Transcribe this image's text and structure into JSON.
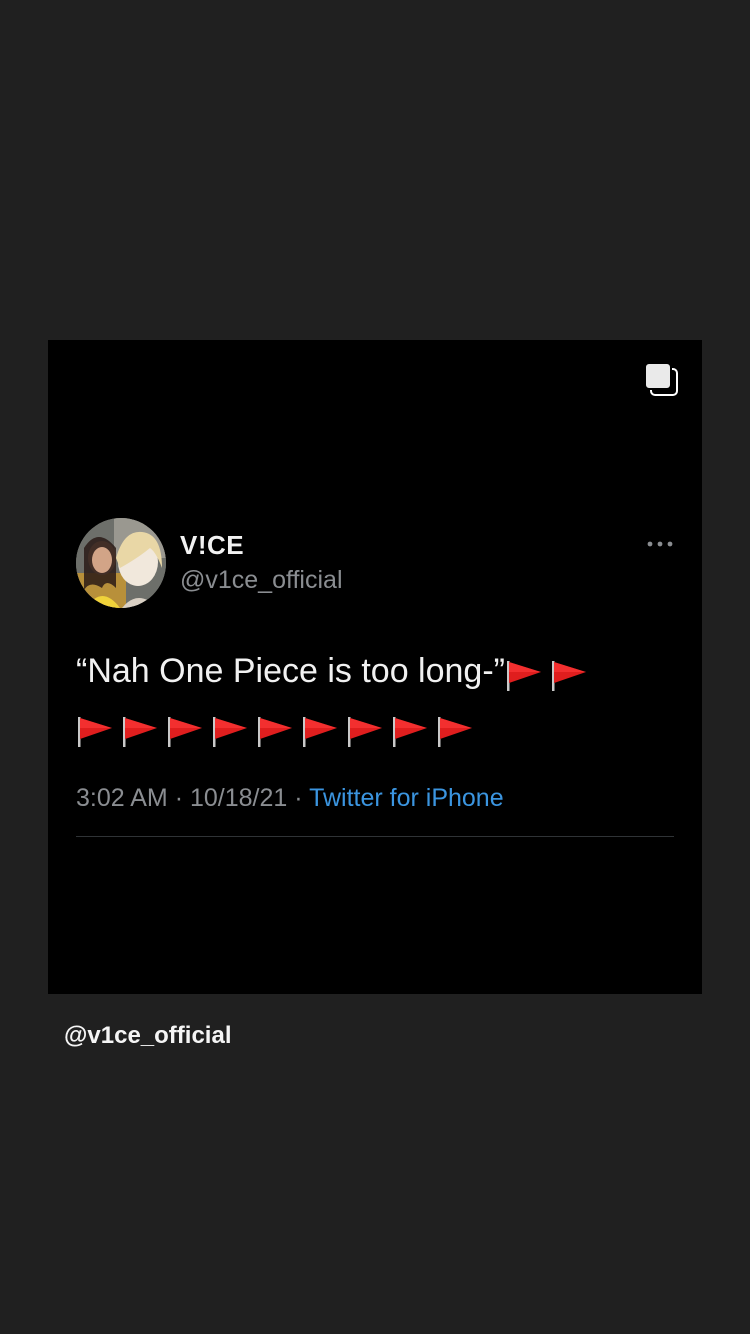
{
  "post": {
    "tweet": {
      "display_name": "V!CE",
      "handle": "@v1ce_official",
      "text": "“Nah One Piece is too long-”",
      "time": "3:02 AM",
      "separator": "·",
      "date": "10/18/21",
      "source": "Twitter for iPhone",
      "red_flag_count": 11,
      "source_color": "#3b95e0"
    }
  },
  "caption": "@v1ce_official",
  "icons": {
    "multi": "multiple-images-icon",
    "more": "more-horizontal-icon",
    "flag": "red-flag-icon"
  }
}
